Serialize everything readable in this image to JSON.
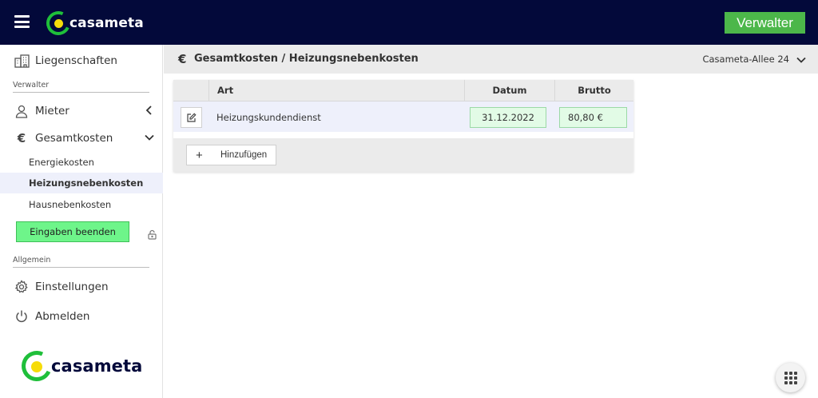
{
  "topbar": {
    "logo_text": "casameta",
    "role": "Verwalter"
  },
  "sidebar": {
    "properties": "Liegenschaften",
    "section_manager": "Verwalter",
    "tenants": "Mieter",
    "total_costs": "Gesamtkosten",
    "sub_items": [
      "Energiekosten",
      "Heizungsnebenkosten",
      "Hausnebenkosten"
    ],
    "active_sub_item": "Heizungsnebenkosten",
    "finish_button": "Eingaben beenden",
    "section_general": "Allgemein",
    "settings": "Einstellungen",
    "logout": "Abmelden",
    "footer_logo_text": "casameta"
  },
  "header": {
    "currency_symbol": "€",
    "breadcrumb": "Gesamtkosten / Heizungsnebenkosten",
    "property": "Casameta-Allee 24"
  },
  "table": {
    "columns": [
      "Art",
      "Datum",
      "Brutto"
    ],
    "rows": [
      {
        "art": "Heizungskundendienst",
        "datum": "31.12.2022",
        "brutto": "80,80 €"
      }
    ],
    "add_button": "Hinzufügen"
  },
  "colors": {
    "topbar_bg": "#03093a",
    "brand_green": "#1fbf3a",
    "brand_yellow": "#f6dc0a",
    "role_badge": "#4cb74a",
    "finish_button": "#6ef58a",
    "active_row": "#eef0fb"
  },
  "icons": {
    "menu": "hamburger-icon",
    "properties": "buildings-icon",
    "tenants": "user-icon",
    "costs": "euro-icon",
    "settings": "gear-icon",
    "logout": "power-icon",
    "lock": "lock-open-icon",
    "edit": "edit-icon",
    "apps": "grid-icon"
  }
}
